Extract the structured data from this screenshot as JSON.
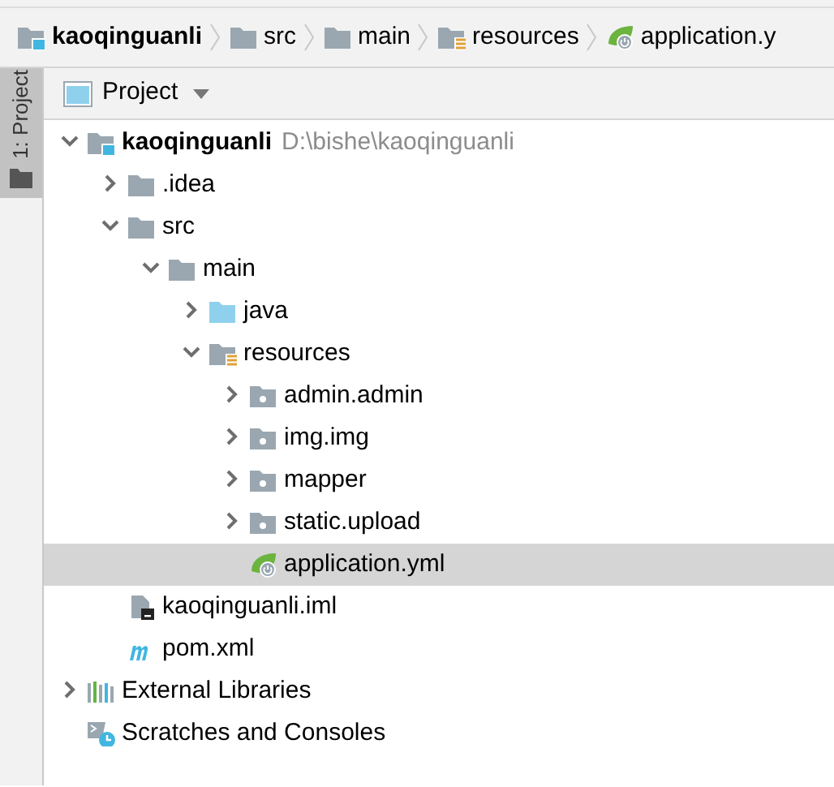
{
  "breadcrumb": [
    {
      "label": "kaoqinguanli",
      "kind": "module"
    },
    {
      "label": "src",
      "kind": "folder"
    },
    {
      "label": "main",
      "kind": "folder"
    },
    {
      "label": "resources",
      "kind": "resources"
    },
    {
      "label": "application.y",
      "kind": "spring"
    }
  ],
  "tool_strip": {
    "tab": {
      "label": "1: Project",
      "selected": true
    }
  },
  "panel": {
    "title": "Project"
  },
  "tree": [
    {
      "label": "kaoqinguanli",
      "path": "D:\\bishe\\kaoqinguanli",
      "kind": "module",
      "expanded": true,
      "selected": false,
      "children": [
        {
          "label": ".idea",
          "kind": "folder",
          "expanded": false,
          "selected": false
        },
        {
          "label": "src",
          "kind": "folder",
          "expanded": true,
          "selected": false,
          "children": [
            {
              "label": "main",
              "kind": "folder",
              "expanded": true,
              "selected": false,
              "children": [
                {
                  "label": "java",
                  "kind": "source",
                  "expanded": false,
                  "selected": false
                },
                {
                  "label": "resources",
                  "kind": "resources",
                  "expanded": true,
                  "selected": false,
                  "children": [
                    {
                      "label": "admin.admin",
                      "kind": "package",
                      "expanded": false,
                      "selected": false
                    },
                    {
                      "label": "img.img",
                      "kind": "package",
                      "expanded": false,
                      "selected": false
                    },
                    {
                      "label": "mapper",
                      "kind": "package",
                      "expanded": false,
                      "selected": false
                    },
                    {
                      "label": "static.upload",
                      "kind": "package",
                      "expanded": false,
                      "selected": false
                    },
                    {
                      "label": "application.yml",
                      "kind": "spring",
                      "selected": true
                    }
                  ]
                }
              ]
            }
          ]
        },
        {
          "label": "kaoqinguanli.iml",
          "kind": "iml",
          "selected": false
        },
        {
          "label": "pom.xml",
          "kind": "maven",
          "selected": false
        }
      ]
    },
    {
      "label": "External Libraries",
      "kind": "libraries",
      "expanded": false,
      "selected": false
    },
    {
      "label": "Scratches and Consoles",
      "kind": "scratches",
      "selected": false
    }
  ]
}
